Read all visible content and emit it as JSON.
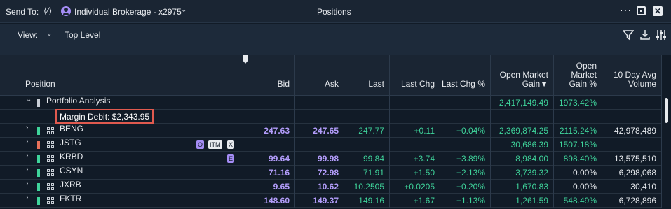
{
  "topbar": {
    "send_to": "Send To:",
    "account": "Individual Brokerage - x2975",
    "title": "Positions"
  },
  "viewbar": {
    "view_label": "View:",
    "level": "Top Level"
  },
  "columns": [
    "Position",
    "Bid",
    "Ask",
    "Last",
    "Last Chg",
    "Last Chg %",
    "Open Market Gain▼",
    "Open Market Gain %",
    "10 Day Avg Volume"
  ],
  "group": {
    "name": "Portfolio Analysis",
    "open_gain": "2,417,149.49",
    "open_gain_pct": "1973.42%",
    "margin": "Margin Debit: $2,343.95"
  },
  "rows": [
    {
      "symbol": "BENG",
      "bar": "#3fd49b",
      "bid": "247.63",
      "ask": "247.65",
      "last": "247.77",
      "chg": "+0.11",
      "chgpct": "+0.04%",
      "gain": "2,369,874.25",
      "gainpct": "2115.24%",
      "vol": "42,978,489",
      "tags": []
    },
    {
      "symbol": "JSTG",
      "bar": "#e8715a",
      "bid": "",
      "ask": "",
      "last": "",
      "chg": "",
      "chgpct": "",
      "gain": "30,686.39",
      "gainpct": "1507.18%",
      "vol": "",
      "tags": [
        "O",
        "ITM",
        "X"
      ]
    },
    {
      "symbol": "KRBD",
      "bar": "#3fd49b",
      "bid": "99.64",
      "ask": "99.98",
      "last": "99.84",
      "chg": "+3.74",
      "chgpct": "+3.89%",
      "gain": "8,984.00",
      "gainpct": "898.40%",
      "vol": "13,575,510",
      "tags": [
        "E"
      ]
    },
    {
      "symbol": "CSYN",
      "bar": "#3fd49b",
      "bid": "71.16",
      "ask": "72.98",
      "last": "71.91",
      "chg": "+1.50",
      "chgpct": "+2.13%",
      "gain": "3,739.32",
      "gainpct": "0.00%",
      "vol": "6,298,068",
      "tags": []
    },
    {
      "symbol": "JXRB",
      "bar": "#3fd49b",
      "bid": "9.65",
      "ask": "10.62",
      "last": "10.2505",
      "chg": "+0.0205",
      "chgpct": "+0.20%",
      "gain": "1,670.83",
      "gainpct": "0.00%",
      "vol": "30,410",
      "tags": []
    },
    {
      "symbol": "FKTR",
      "bar": "#3fd49b",
      "bid": "148.60",
      "ask": "149.37",
      "last": "149.16",
      "chg": "+1.67",
      "chgpct": "+1.13%",
      "gain": "1,261.59",
      "gainpct": "548.49%",
      "vol": "6,728,896",
      "tags": []
    }
  ]
}
